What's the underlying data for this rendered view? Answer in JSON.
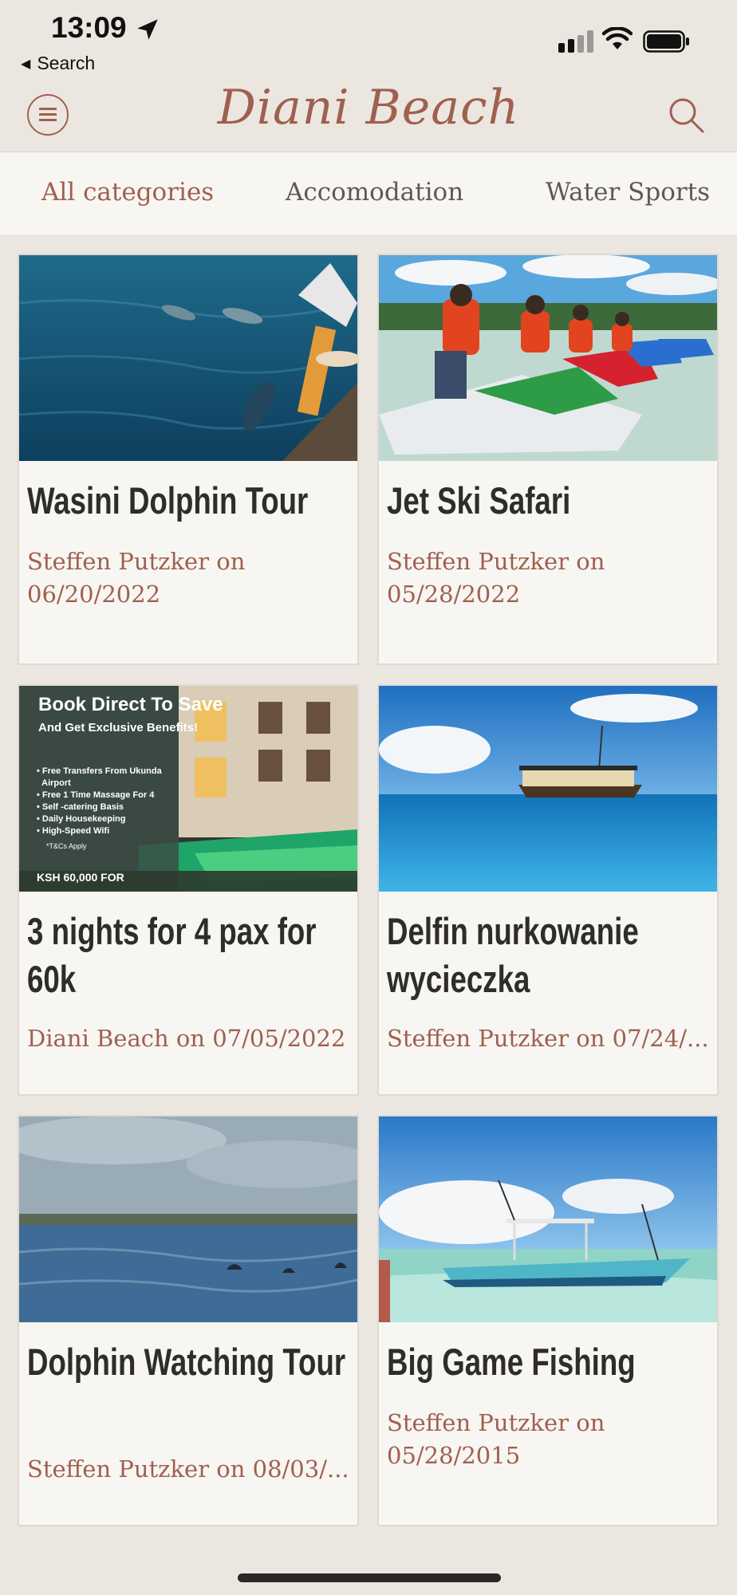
{
  "status_bar": {
    "time": "13:09",
    "back_label": "Search",
    "icons": [
      "location-arrow-icon",
      "cellular-signal-icon",
      "wifi-icon",
      "battery-icon"
    ]
  },
  "header": {
    "title": "Diani Beach",
    "menu_icon": "hamburger-menu-icon",
    "search_icon": "search-icon",
    "accent_color": "#a0604f"
  },
  "tabs": [
    {
      "label": "All categories",
      "active": true
    },
    {
      "label": "Accomodation",
      "active": false
    },
    {
      "label": "Water Sports",
      "active": false
    }
  ],
  "cards": [
    {
      "title": "Wasini Dolphin Tour",
      "meta": "Steffen Putzker on 06/20/2022",
      "image": "dolphins-boat-photo"
    },
    {
      "title": "Jet Ski Safari",
      "meta": "Steffen Putzker on 05/28/2022",
      "image": "jet-skis-photo"
    },
    {
      "title": "3 nights for 4 pax for 60k",
      "meta": "Diani Beach on 07/05/2022",
      "image": "hotel-promo-photo",
      "promo": {
        "headline": "Book Direct To Save",
        "subline": "And Get Exclusive Benefits!",
        "items": [
          "Free Transfers From Ukunda",
          "Airport",
          "Free 1 Time Massage For 4",
          "Self -catering Basis",
          "Daily Housekeeping",
          "High-Speed Wifi"
        ],
        "terms": "*T&Cs Apply",
        "price": "KSH 60,000 FOR"
      }
    },
    {
      "title": "Delfin nurkowanie wycieczka",
      "meta": "Steffen Putzker on 07/24/...",
      "image": "dhow-boat-sea-photo"
    },
    {
      "title": "Dolphin Watching Tour",
      "meta": "Steffen Putzker on 08/03/...",
      "image": "dolphins-sea-photo"
    },
    {
      "title": "Big Game Fishing",
      "meta": "Steffen Putzker on 05/28/2015",
      "image": "fishing-boat-photo"
    }
  ]
}
